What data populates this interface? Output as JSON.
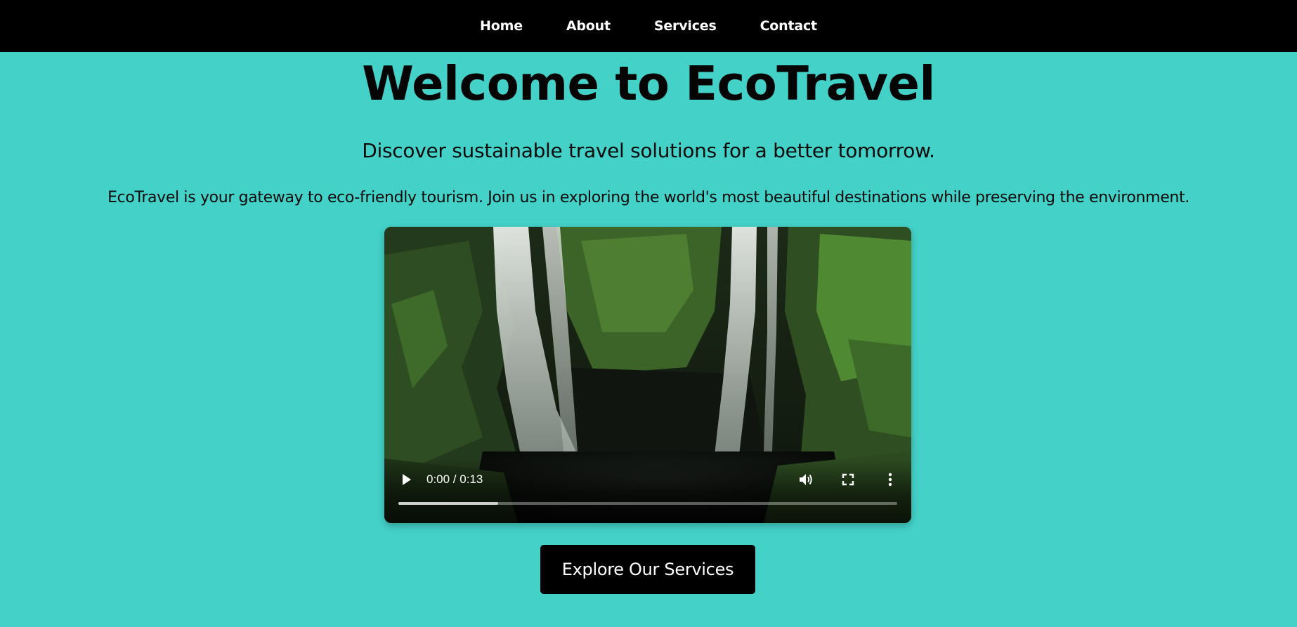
{
  "nav": {
    "items": [
      {
        "label": "Home"
      },
      {
        "label": "About"
      },
      {
        "label": "Services"
      },
      {
        "label": "Contact"
      }
    ]
  },
  "hero": {
    "title": "Welcome to EcoTravel",
    "subtitle": "Discover sustainable travel solutions for a better tomorrow.",
    "description": "EcoTravel is your gateway to eco-friendly tourism. Join us in exploring the world's most beautiful destinations while preserving the environment."
  },
  "video": {
    "time_display": "0:00 / 0:13",
    "buffered_fraction": 0.2,
    "icons": {
      "play": "play-icon",
      "volume": "volume-icon",
      "fullscreen": "fullscreen-icon",
      "more": "more-vertical-icon"
    }
  },
  "cta": {
    "label": "Explore Our Services"
  },
  "colors": {
    "page_background": "#43d1c8",
    "navbar_background": "#000000",
    "button_background": "#000000",
    "button_text": "#ffffff"
  }
}
